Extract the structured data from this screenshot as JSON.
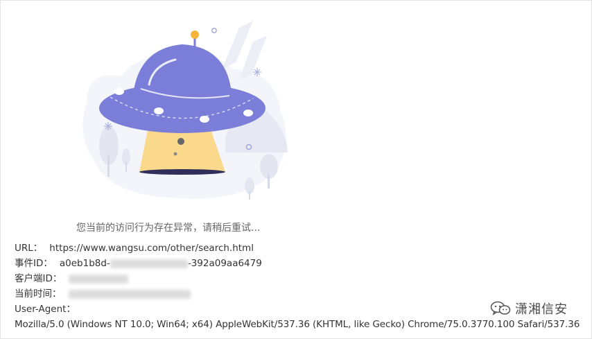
{
  "message": "您当前的访问行为存在异常，请稍后重试...",
  "info": {
    "url_label": "URL：",
    "url_value": "https://www.wangsu.com/other/search.html",
    "event_label": "事件ID：",
    "event_prefix": "a0eb1b8d-",
    "event_suffix": "-392a09aa6479",
    "client_label": "客户端ID：",
    "time_label": "当前时间：",
    "ua_label": "User-Agent：",
    "ua_value": "Mozilla/5.0 (Windows NT 10.0; Win64; x64) AppleWebKit/537.36 (KHTML, like Gecko) Chrome/75.0.3770.100 Safari/537.36"
  },
  "watermark": {
    "text": "潇湘信安",
    "icon": "wechat-icon"
  },
  "colors": {
    "ufo_body": "#7b7ed8",
    "ufo_dark": "#6a6dcc",
    "beam": "#fbd98c",
    "antenna_ball": "#f5b43a",
    "background_shapes": "#eef0f7"
  }
}
